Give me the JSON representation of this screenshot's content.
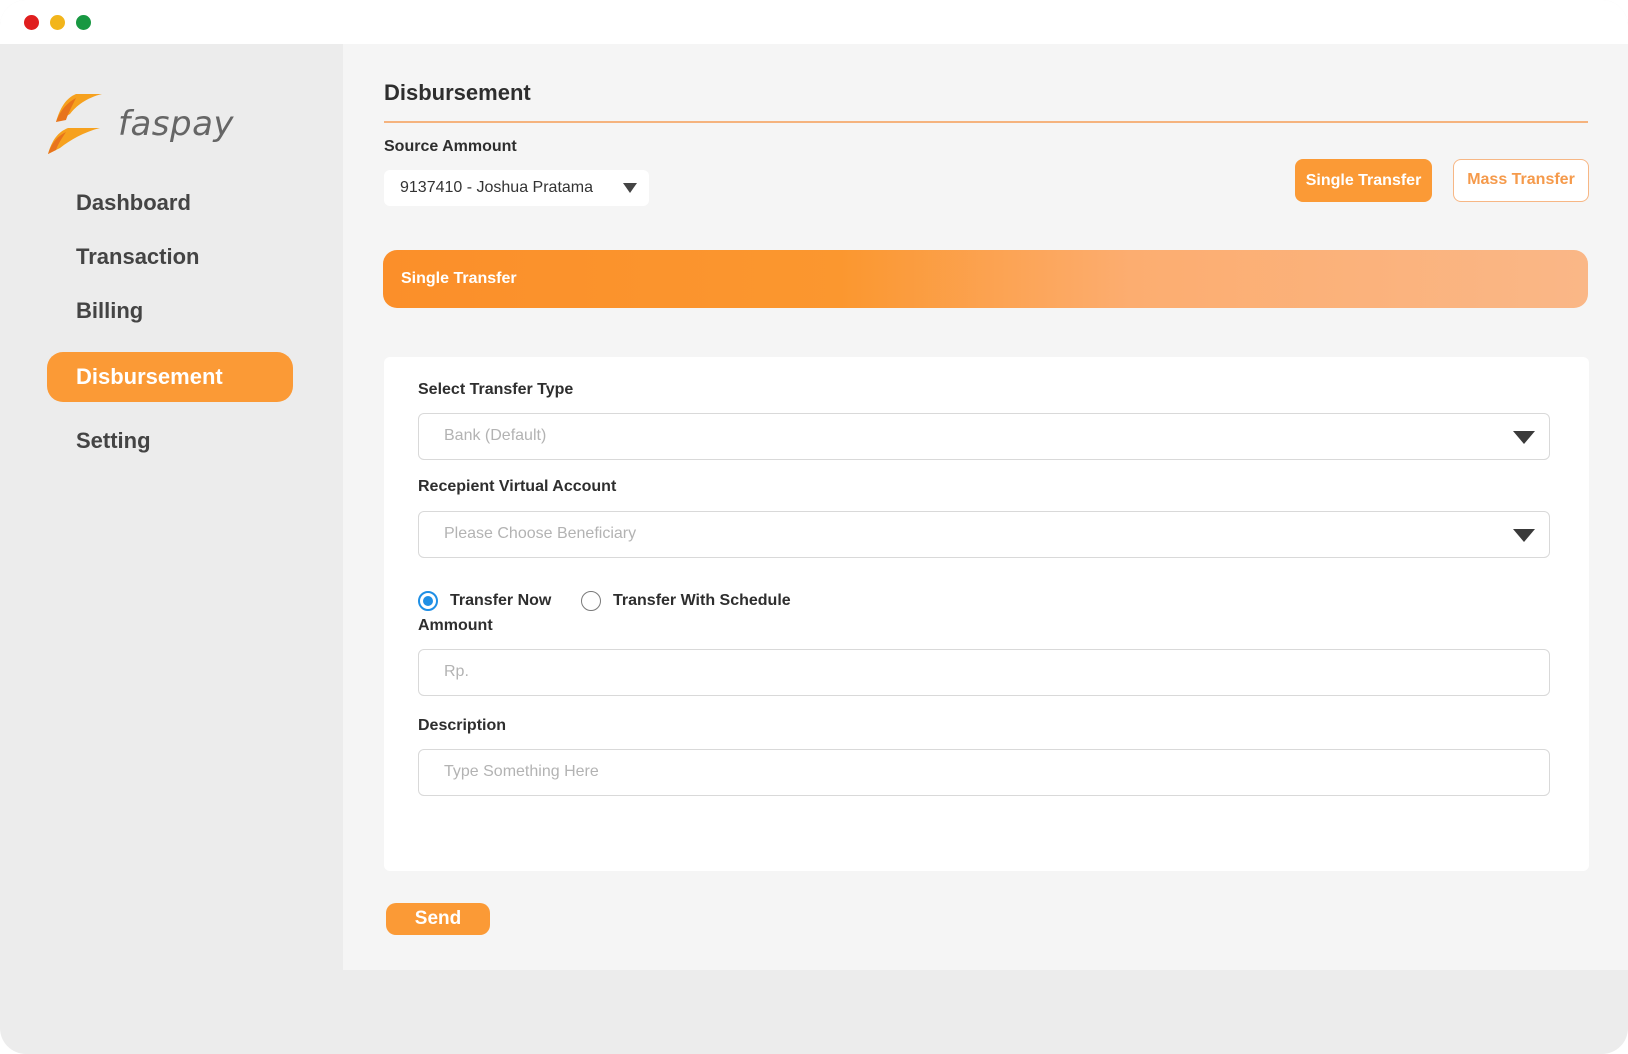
{
  "window": {
    "controls": [
      "close",
      "minimize",
      "zoom"
    ]
  },
  "brand": {
    "logo_text": "faspay",
    "colors": {
      "primary": "#fb9a36",
      "accent_dark": "#e8741c",
      "text": "#2e2e2e"
    }
  },
  "sidebar": {
    "items": [
      {
        "label": "Dashboard",
        "active": false
      },
      {
        "label": "Transaction",
        "active": false
      },
      {
        "label": "Billing",
        "active": false
      },
      {
        "label": "Disbursement",
        "active": true
      },
      {
        "label": "Setting",
        "active": false
      }
    ]
  },
  "header": {
    "title": "Disbursement",
    "source_label": "Source Ammount",
    "source_value": "9137410 - Joshua Pratama",
    "buttons": {
      "single": "Single Transfer",
      "mass": "Mass Transfer"
    }
  },
  "banner": {
    "title": "Single Transfer"
  },
  "form": {
    "transfer_type": {
      "label": "Select Transfer Type",
      "placeholder": "Bank (Default)"
    },
    "recipient": {
      "label": "Recepient Virtual Account",
      "placeholder": "Please Choose Beneficiary"
    },
    "timing": {
      "options": [
        "Transfer Now",
        "Transfer With Schedule"
      ],
      "selected": "Transfer Now"
    },
    "amount": {
      "label": "Ammount",
      "placeholder": "Rp."
    },
    "description": {
      "label": "Description",
      "placeholder": "Type Something Here"
    }
  },
  "actions": {
    "send_label": "Send"
  }
}
